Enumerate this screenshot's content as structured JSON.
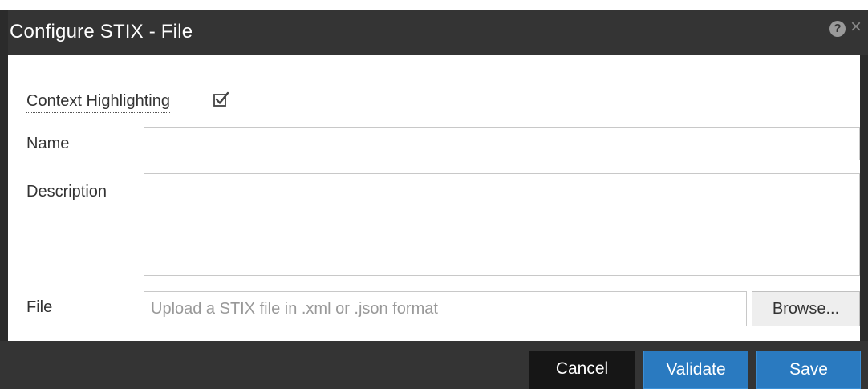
{
  "dialog": {
    "title": "Configure STIX - File",
    "help_glyph": "?",
    "close_glyph": "×"
  },
  "form": {
    "context_highlighting": {
      "label": "Context Highlighting",
      "checked": true
    },
    "name": {
      "label": "Name",
      "value": ""
    },
    "description": {
      "label": "Description",
      "value": ""
    },
    "file": {
      "label": "File",
      "value": "",
      "placeholder": "Upload a STIX file in .xml or .json format",
      "browse_label": "Browse..."
    }
  },
  "footer": {
    "cancel_label": "Cancel",
    "validate_label": "Validate",
    "save_label": "Save"
  },
  "colors": {
    "titlebar": "#343434",
    "primary_button": "#2a7ac0",
    "cancel_button": "#161616"
  },
  "icons": [
    "help-icon",
    "close-icon",
    "checkbox-checked-icon"
  ]
}
